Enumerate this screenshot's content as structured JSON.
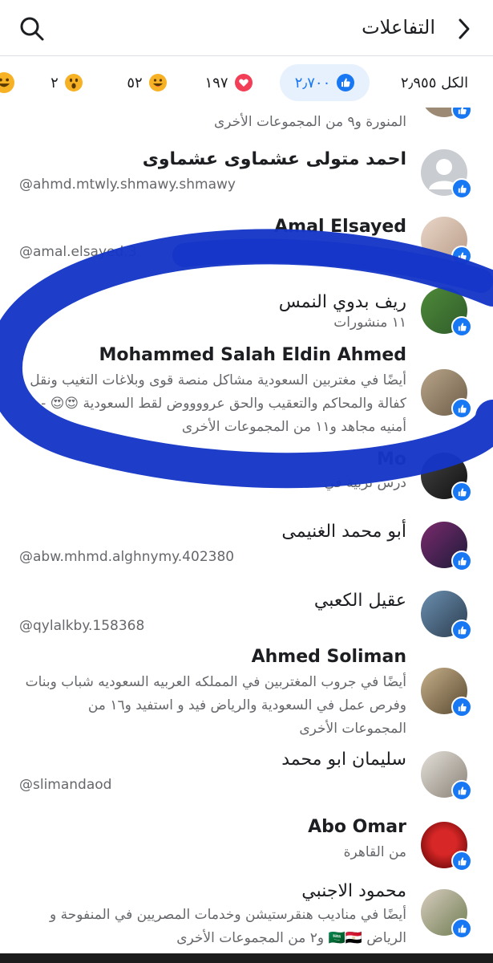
{
  "header": {
    "title": "التفاعلات"
  },
  "tabs": [
    {
      "label": "الكل ٢٫٩٥٥",
      "icon": "",
      "active": false
    },
    {
      "label": "٢٫٧٠٠",
      "icon": "like-icon",
      "active": true
    },
    {
      "label": "١٩٧",
      "icon": "love-icon",
      "active": false
    },
    {
      "label": "٥٢",
      "icon": "haha-icon",
      "active": false
    },
    {
      "label": "٢",
      "icon": "wow-icon",
      "active": false
    }
  ],
  "rows": [
    {
      "name": "",
      "sub": "المنورة و٩ من المجموعات الأخرى"
    },
    {
      "name": "احمد متولى عشماوى عشماوى",
      "sub": "@ahmd.mtwly.shmawy.shmawy"
    },
    {
      "name": "Amal Elsayed",
      "sub": "@amal.elsayed.3"
    },
    {
      "name": "ريف بدوي النمس",
      "sub": "١١ منشورات"
    },
    {
      "name": "Mohammed Salah Eldin Ahmed",
      "sub": "أيضًا في مغتربين السعودية مشاكل منصة قوى وبلاغات التغيب ونقل كفالة والمحاكم والتعقيب والحق عرووووض لقط السعودية 😍😍 - أمنيه مجاهد و١١ من المجموعات الأخرى"
    },
    {
      "name": "Mo",
      "sub": "درس تربية في"
    },
    {
      "name": "أبو محمد الغنيمى",
      "sub": "@abw.mhmd.alghnymy.402380"
    },
    {
      "name": "عقيل الكعبي",
      "sub": "@qylalkby.158368"
    },
    {
      "name": "Ahmed Soliman",
      "sub": "أيضًا في جروب المغتربين في المملكه العربيه السعوديه شباب وبنات وفرص عمل في السعودية والرياض فيد و استفيد و١٦ من المجموعات الأخرى"
    },
    {
      "name": "سليمان ابو محمد",
      "sub": "@slimandaod"
    },
    {
      "name": "Abo Omar",
      "sub": "من القاهرة"
    },
    {
      "name": "محمود الاجنبي",
      "sub": "أيضًا في مناديب هنقرستيشن وخدمات المصريين في المنفوحة و الرياض 🇸🇦🇪🇬 و٢ من المجموعات الأخرى"
    }
  ],
  "colors": {
    "accent": "#1877f2",
    "scribble": "#1536c8",
    "love": "#f33e58",
    "text_secondary": "#65676b"
  },
  "icons": {
    "back": "chevron-right-icon",
    "search": "search-icon",
    "like": "like-icon"
  }
}
